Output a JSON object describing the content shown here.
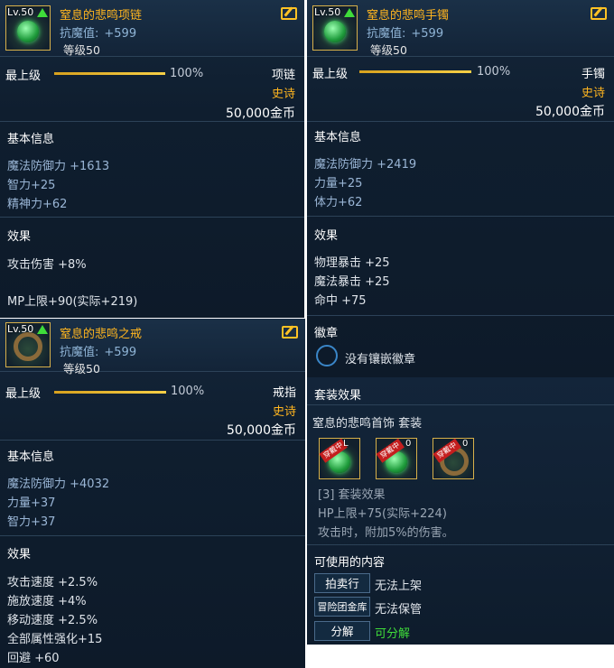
{
  "necklace": {
    "level": "Lv.50",
    "name": "窒息的悲鸣项链",
    "magic_resist_label": "抗魔值:",
    "magic_resist_value": "+599",
    "req_level": "等级50",
    "max_level_label": "最上级",
    "progress_percent": "100%",
    "progress": 1.0,
    "slot": "项链",
    "rarity": "史诗",
    "price": "50,000金币",
    "basic_info_title": "基本信息",
    "stats": [
      "魔法防御力 +1613",
      "智力+25",
      "精神力+62"
    ],
    "effects_title": "效果",
    "effects": [
      "攻击伤害 +8%",
      "MP上限+90(实际+219)"
    ]
  },
  "bracelet": {
    "level": "Lv.50",
    "name": "窒息的悲鸣手镯",
    "magic_resist_label": "抗魔值:",
    "magic_resist_value": "+599",
    "req_level": "等级50",
    "max_level_label": "最上级",
    "progress_percent": "100%",
    "progress": 1.0,
    "slot": "手镯",
    "rarity": "史诗",
    "price": "50,000金币",
    "basic_info_title": "基本信息",
    "stats": [
      "魔法防御力 +2419",
      "力量+25",
      "体力+62"
    ],
    "effects_title": "效果",
    "effects": [
      "物理暴击 +25",
      "魔法暴击 +25",
      "命中 +75"
    ],
    "emblem_title": "徽章",
    "emblem_text": "没有镶嵌徽章"
  },
  "ring": {
    "level": "Lv.50",
    "name": "窒息的悲鸣之戒",
    "magic_resist_label": "抗魔值:",
    "magic_resist_value": "+599",
    "req_level": "等级50",
    "max_level_label": "最上级",
    "progress_percent": "100%",
    "progress": 1.0,
    "slot": "戒指",
    "rarity": "史诗",
    "price": "50,000金币",
    "basic_info_title": "基本信息",
    "stats": [
      "魔法防御力 +4032",
      "力量+37",
      "智力+37"
    ],
    "effects_title": "效果",
    "effects": [
      "攻击速度 +2.5%",
      "施放速度 +4%",
      "移动速度 +2.5%",
      "全部属性强化+15",
      "回避 +60"
    ]
  },
  "set": {
    "title": "套装效果",
    "set_name": "窒息的悲鸣首饰 套装",
    "badge": "穿戴中",
    "item_level_partial": [
      "L",
      "0",
      "0"
    ],
    "tier_label": "[3] 套装效果",
    "tier_effects": [
      "HP上限+75(实际+224)",
      "攻击时，附加5%的伤害。"
    ],
    "usable_title": "可使用的内容",
    "rows": [
      {
        "button": "拍卖行",
        "status": "无法上架",
        "color": "#ffffff"
      },
      {
        "button": "冒险团金库",
        "status": "无法保管",
        "color": "#ffffff"
      },
      {
        "button": "分解",
        "status": "可分解",
        "color": "#3fdc3a"
      }
    ]
  },
  "colors": {
    "gold": "#ffb51f",
    "green": "#3fdc3a",
    "panel": "#0f1e2f"
  },
  "icons": [
    "level-up-arrow-icon",
    "edit-icon",
    "emblem-slot-icon"
  ]
}
